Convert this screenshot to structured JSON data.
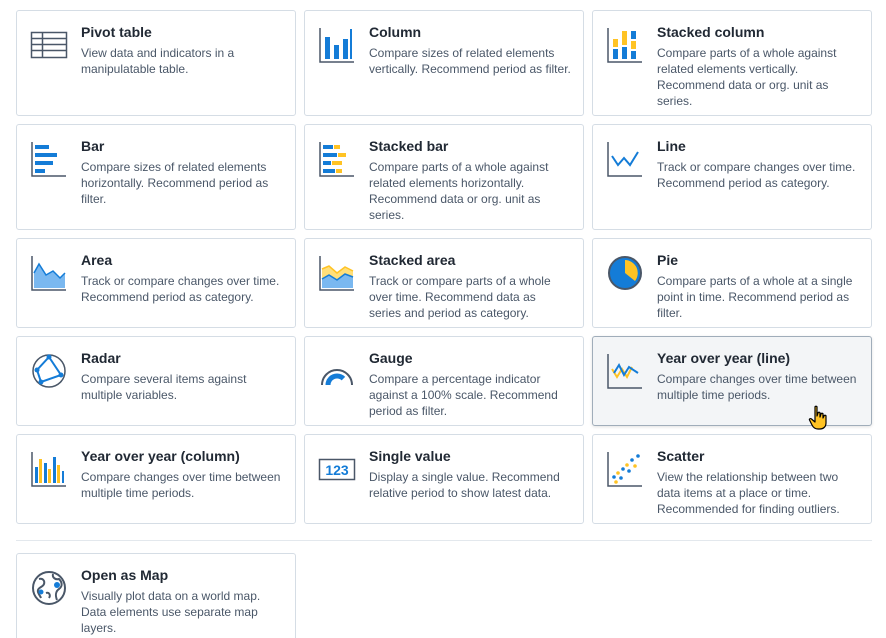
{
  "colors": {
    "icon_dark": "#4a5768",
    "icon_blue": "#147cd7",
    "icon_yellow": "#ffc324",
    "icon_light_blue": "#7ab8f0"
  },
  "cards": [
    {
      "name": "pivot-table",
      "icon": "pivot-table-icon",
      "title": "Pivot table",
      "description": "View data and indicators in a manipulatable table."
    },
    {
      "name": "column",
      "icon": "column-chart-icon",
      "title": "Column",
      "description": "Compare sizes of related elements vertically. Recommend period as filter."
    },
    {
      "name": "stacked-column",
      "icon": "stacked-column-chart-icon",
      "title": "Stacked column",
      "description": "Compare parts of a whole against related elements vertically. Recommend data or org. unit as series."
    },
    {
      "name": "bar",
      "icon": "bar-chart-icon",
      "title": "Bar",
      "description": "Compare sizes of related elements horizontally. Recommend period as filter."
    },
    {
      "name": "stacked-bar",
      "icon": "stacked-bar-chart-icon",
      "title": "Stacked bar",
      "description": "Compare parts of a whole against related elements horizontally. Recommend data or org. unit as series."
    },
    {
      "name": "line",
      "icon": "line-chart-icon",
      "title": "Line",
      "description": "Track or compare changes over time. Recommend period as category."
    },
    {
      "name": "area",
      "icon": "area-chart-icon",
      "title": "Area",
      "description": "Track or compare changes over time. Recommend period as category."
    },
    {
      "name": "stacked-area",
      "icon": "stacked-area-chart-icon",
      "title": "Stacked area",
      "description": "Track or compare parts of a whole over time. Recommend data as series and period as category."
    },
    {
      "name": "pie",
      "icon": "pie-chart-icon",
      "title": "Pie",
      "description": "Compare parts of a whole at a single point in time. Recommend period as filter."
    },
    {
      "name": "radar",
      "icon": "radar-chart-icon",
      "title": "Radar",
      "description": "Compare several items against multiple variables."
    },
    {
      "name": "gauge",
      "icon": "gauge-chart-icon",
      "title": "Gauge",
      "description": "Compare a percentage indicator against a 100% scale. Recommend period as filter."
    },
    {
      "name": "year-over-year-line",
      "icon": "year-over-year-line-icon",
      "title": "Year over year (line)",
      "description": "Compare changes over time between multiple time periods."
    },
    {
      "name": "year-over-year-column",
      "icon": "year-over-year-column-icon",
      "title": "Year over year (column)",
      "description": "Compare changes over time between multiple time periods."
    },
    {
      "name": "single-value",
      "icon": "single-value-icon",
      "title": "Single value",
      "description": "Display a single value. Recommend relative period to show latest data.",
      "icon_text": "123"
    },
    {
      "name": "scatter",
      "icon": "scatter-chart-icon",
      "title": "Scatter",
      "description": "View the relationship between two data items at a place or time. Recommended for finding outliers."
    }
  ],
  "map_card": {
    "name": "open-as-map",
    "icon": "globe-map-icon",
    "title": "Open as Map",
    "description": "Visually plot data on a world map. Data elements use separate map layers."
  }
}
